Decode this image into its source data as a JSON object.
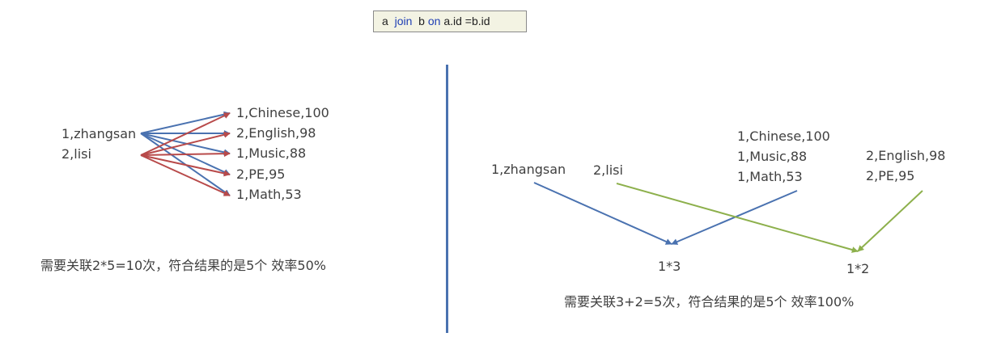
{
  "query": {
    "a": "a",
    "join": "join",
    "b": "b",
    "on": "on",
    "condition": "a.id =b.id"
  },
  "left": {
    "users": [
      "1,zhangsan",
      "2,lisi"
    ],
    "scores": [
      "1,Chinese,100",
      "2,English,98",
      "1,Music,88",
      "2,PE,95",
      "1,Math,53"
    ],
    "caption": "需要关联2*5=10次，符合结果的是5个 效率50%"
  },
  "right": {
    "user_zhangsan": "1,zhangsan",
    "user_lisi": "2,lisi",
    "group1": [
      "1,Chinese,100",
      "1,Music,88",
      "1,Math,53"
    ],
    "group2": [
      "2,English,98",
      "2,PE,95"
    ],
    "count1": "1*3",
    "count2": "1*2",
    "caption": "需要关联3+2=5次，符合结果的是5个 效率100%"
  },
  "colors": {
    "blue": "#4a72b0",
    "red": "#b84a4a",
    "green": "#8db04c",
    "divider": "#4a72b0"
  }
}
